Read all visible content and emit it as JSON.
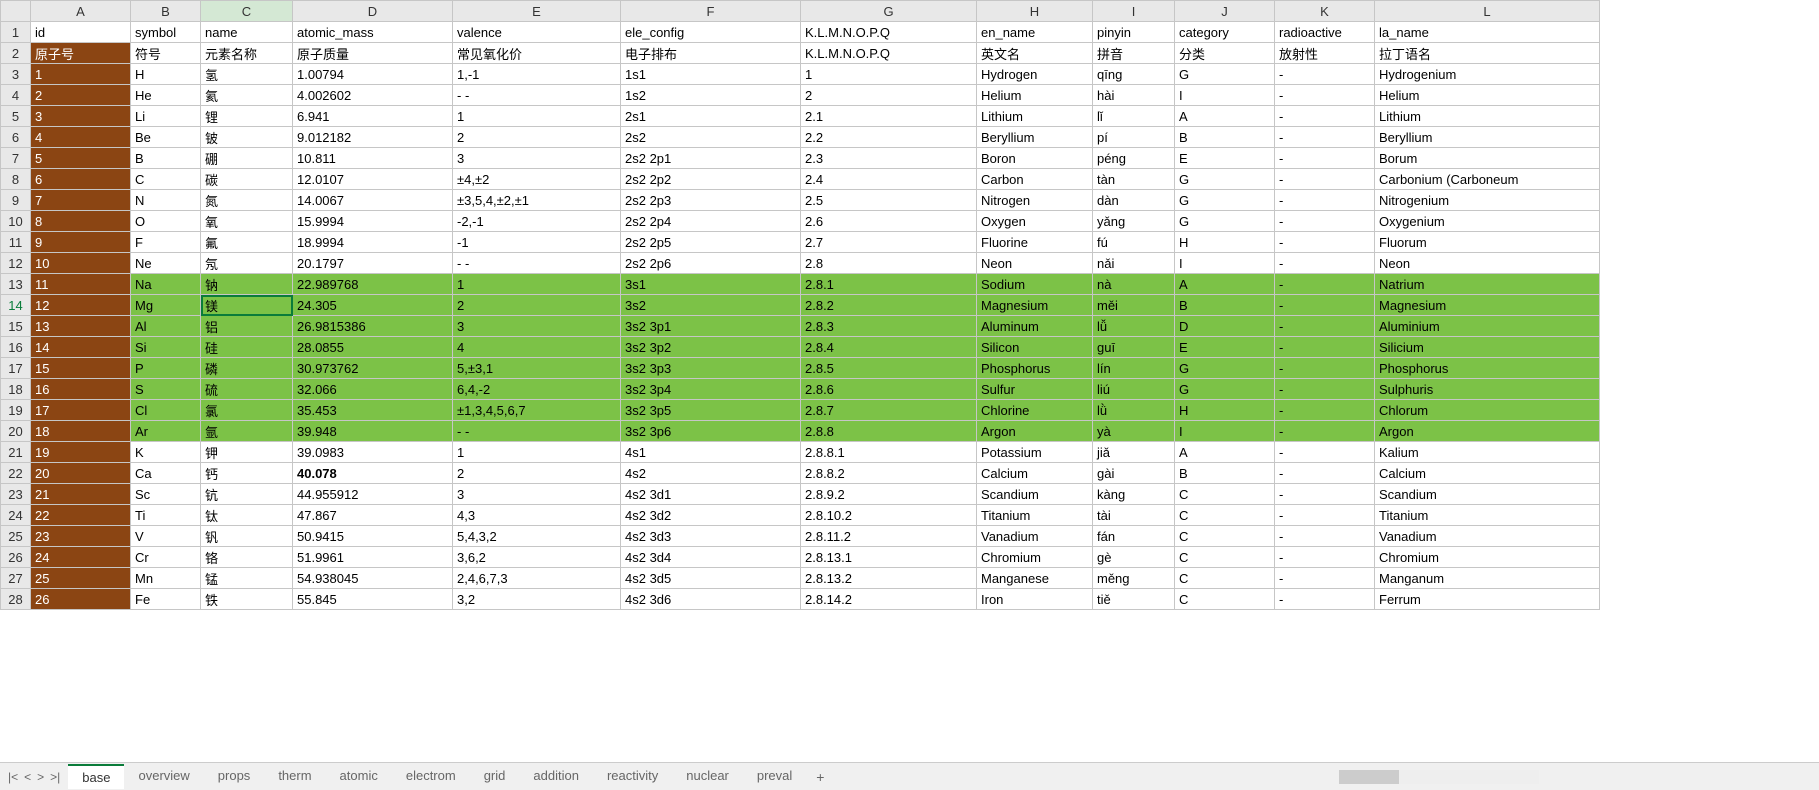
{
  "columns": [
    "",
    "A",
    "B",
    "C",
    "D",
    "E",
    "F",
    "G",
    "H",
    "I",
    "J",
    "K",
    "L"
  ],
  "headers1": [
    "id",
    "symbol",
    "name",
    "atomic_mass",
    "valence",
    "ele_config",
    "K.L.M.N.O.P.Q",
    "en_name",
    "pinyin",
    "category",
    "radioactive",
    "la_name"
  ],
  "headers2": [
    "原子号",
    "符号",
    "元素名称",
    "原子质量",
    "常见氧化价",
    "电子排布",
    "K.L.M.N.O.P.Q",
    "英文名",
    "拼音",
    "分类",
    "放射性",
    "拉丁语名"
  ],
  "rows": [
    {
      "n": 3,
      "hl": false,
      "d": [
        "1",
        "H",
        "氢",
        "1.00794",
        "1,-1",
        "1s1",
        "1",
        "Hydrogen",
        "qīng",
        "G",
        "-",
        "Hydrogenium"
      ]
    },
    {
      "n": 4,
      "hl": false,
      "d": [
        "2",
        "He",
        "氦",
        "4.002602",
        "- -",
        "1s2",
        "2",
        "Helium",
        "hài",
        "I",
        "-",
        "Helium"
      ]
    },
    {
      "n": 5,
      "hl": false,
      "d": [
        "3",
        "Li",
        "锂",
        "6.941",
        "1",
        "2s1",
        "2.1",
        "Lithium",
        "lǐ",
        "A",
        "-",
        "Lithium"
      ]
    },
    {
      "n": 6,
      "hl": false,
      "d": [
        "4",
        "Be",
        "铍",
        "9.012182",
        "2",
        "2s2",
        "2.2",
        "Beryllium",
        "pí",
        "B",
        "-",
        "Beryllium"
      ]
    },
    {
      "n": 7,
      "hl": false,
      "d": [
        "5",
        "B",
        "硼",
        "10.811",
        "3",
        "2s2 2p1",
        "2.3",
        "Boron",
        "péng",
        "E",
        "-",
        "Borum"
      ]
    },
    {
      "n": 8,
      "hl": false,
      "d": [
        "6",
        "C",
        "碳",
        "12.0107",
        "±4,±2",
        "2s2 2p2",
        "2.4",
        "Carbon",
        "tàn",
        "G",
        "-",
        "Carbonium (Carboneum"
      ]
    },
    {
      "n": 9,
      "hl": false,
      "d": [
        "7",
        "N",
        "氮",
        "14.0067",
        "±3,5,4,±2,±1",
        "2s2 2p3",
        "2.5",
        "Nitrogen",
        "dàn",
        "G",
        "-",
        "Nitrogenium"
      ]
    },
    {
      "n": 10,
      "hl": false,
      "d": [
        "8",
        "O",
        "氧",
        "15.9994",
        "-2,-1",
        "2s2 2p4",
        "2.6",
        "Oxygen",
        "yǎng",
        "G",
        "-",
        "Oxygenium"
      ]
    },
    {
      "n": 11,
      "hl": false,
      "d": [
        "9",
        "F",
        "氟",
        "18.9994",
        "-1",
        "2s2 2p5",
        "2.7",
        "Fluorine",
        "fú",
        "H",
        "-",
        "Fluorum"
      ]
    },
    {
      "n": 12,
      "hl": false,
      "d": [
        "10",
        "Ne",
        "氖",
        "20.1797",
        "- -",
        "2s2 2p6",
        "2.8",
        "Neon",
        "nǎi",
        "I",
        "-",
        "Neon"
      ]
    },
    {
      "n": 13,
      "hl": true,
      "d": [
        "11",
        "Na",
        "钠",
        "22.989768",
        "1",
        "3s1",
        "2.8.1",
        "Sodium",
        "nà",
        "A",
        "-",
        "Natrium"
      ]
    },
    {
      "n": 14,
      "hl": true,
      "sel": true,
      "d": [
        "12",
        "Mg",
        "镁",
        "24.305",
        "2",
        "3s2",
        "2.8.2",
        "Magnesium",
        "měi",
        "B",
        "-",
        "Magnesium"
      ]
    },
    {
      "n": 15,
      "hl": true,
      "d": [
        "13",
        "Al",
        "铝",
        "26.9815386",
        "3",
        "3s2 3p1",
        "2.8.3",
        "Aluminum",
        "lǚ",
        "D",
        "-",
        "Aluminium"
      ]
    },
    {
      "n": 16,
      "hl": true,
      "d": [
        "14",
        "Si",
        "硅",
        "28.0855",
        "4",
        "3s2 3p2",
        "2.8.4",
        "Silicon",
        "guī",
        "E",
        "-",
        "Silicium"
      ]
    },
    {
      "n": 17,
      "hl": true,
      "d": [
        "15",
        "P",
        "磷",
        "30.973762",
        "5,±3,1",
        "3s2 3p3",
        "2.8.5",
        "Phosphorus",
        "lín",
        "G",
        "-",
        "Phosphorus"
      ]
    },
    {
      "n": 18,
      "hl": true,
      "d": [
        "16",
        "S",
        "硫",
        "32.066",
        "6,4,-2",
        "3s2 3p4",
        "2.8.6",
        "Sulfur",
        "liú",
        "G",
        "-",
        "Sulphuris"
      ]
    },
    {
      "n": 19,
      "hl": true,
      "d": [
        "17",
        "Cl",
        "氯",
        "35.453",
        "±1,3,4,5,6,7",
        "3s2 3p5",
        "2.8.7",
        "Chlorine",
        "lǜ",
        "H",
        "-",
        "Chlorum"
      ]
    },
    {
      "n": 20,
      "hl": true,
      "d": [
        "18",
        "Ar",
        "氩",
        "39.948",
        "- -",
        "3s2 3p6",
        "2.8.8",
        "Argon",
        "yà",
        "I",
        "-",
        "Argon"
      ]
    },
    {
      "n": 21,
      "hl": false,
      "d": [
        "19",
        "K",
        "钾",
        "39.0983",
        "1",
        "4s1",
        "2.8.8.1",
        "Potassium",
        "jiǎ",
        "A",
        "-",
        "Kalium"
      ]
    },
    {
      "n": 22,
      "hl": false,
      "bold": true,
      "d": [
        "20",
        "Ca",
        "钙",
        "40.078",
        "2",
        "4s2",
        "2.8.8.2",
        "Calcium",
        "gài",
        "B",
        "-",
        "Calcium"
      ]
    },
    {
      "n": 23,
      "hl": false,
      "d": [
        "21",
        "Sc",
        "钪",
        "44.955912",
        "3",
        "4s2 3d1",
        "2.8.9.2",
        "Scandium",
        "kàng",
        "C",
        "-",
        "Scandium"
      ]
    },
    {
      "n": 24,
      "hl": false,
      "d": [
        "22",
        "Ti",
        "钛",
        "47.867",
        "4,3",
        "4s2 3d2",
        "2.8.10.2",
        "Titanium",
        "tài",
        "C",
        "-",
        "Titanium"
      ]
    },
    {
      "n": 25,
      "hl": false,
      "d": [
        "23",
        "V",
        "钒",
        "50.9415",
        "5,4,3,2",
        "4s2 3d3",
        "2.8.11.2",
        "Vanadium",
        "fán",
        "C",
        "-",
        "Vanadium"
      ]
    },
    {
      "n": 26,
      "hl": false,
      "d": [
        "24",
        "Cr",
        "铬",
        "51.9961",
        "3,6,2",
        "4s2 3d4",
        "2.8.13.1",
        "Chromium",
        "gè",
        "C",
        "-",
        "Chromium"
      ]
    },
    {
      "n": 27,
      "hl": false,
      "d": [
        "25",
        "Mn",
        "锰",
        "54.938045",
        "2,4,6,7,3",
        "4s2 3d5",
        "2.8.13.2",
        "Manganese",
        "měng",
        "C",
        "-",
        "Manganum"
      ]
    },
    {
      "n": 28,
      "hl": false,
      "d": [
        "26",
        "Fe",
        "铁",
        "55.845",
        "3,2",
        "4s2 3d6",
        "2.8.14.2",
        "Iron",
        "tiě",
        "C",
        "-",
        "Ferrum"
      ]
    }
  ],
  "tabs": [
    "base",
    "overview",
    "props",
    "therm",
    "atomic",
    "electrom",
    "grid",
    "addition",
    "reactivity",
    "nuclear",
    "preval"
  ],
  "activeTab": "base",
  "nav": {
    "first": "|<",
    "prev": "<",
    "next": ">",
    "last": ">|"
  },
  "addTab": "+"
}
